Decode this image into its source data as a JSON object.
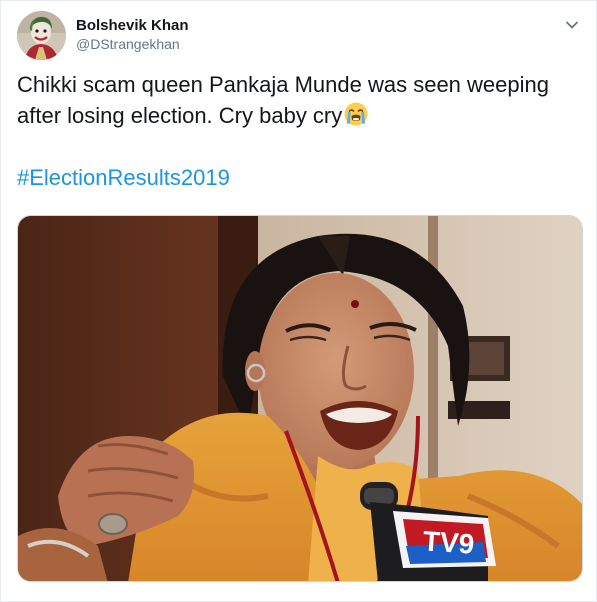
{
  "user": {
    "display_name": "Bolshevik Khan",
    "handle": "@DStrangekhan",
    "avatar_icon": "joker-avatar"
  },
  "tweet": {
    "text": "Chikki scam queen Pankaja Munde was seen weeping after losing election. Cry baby cry",
    "emoji": "loudly-crying-face-emoji",
    "hashtag": "#ElectionResults2019"
  },
  "media": {
    "description_icon": "photo-crying-woman-microphone",
    "mic_logo_text": "TV9"
  },
  "colors": {
    "text": "#14171a",
    "secondary": "#657786",
    "link": "#1b95e0",
    "border": "#e6ecf0"
  }
}
